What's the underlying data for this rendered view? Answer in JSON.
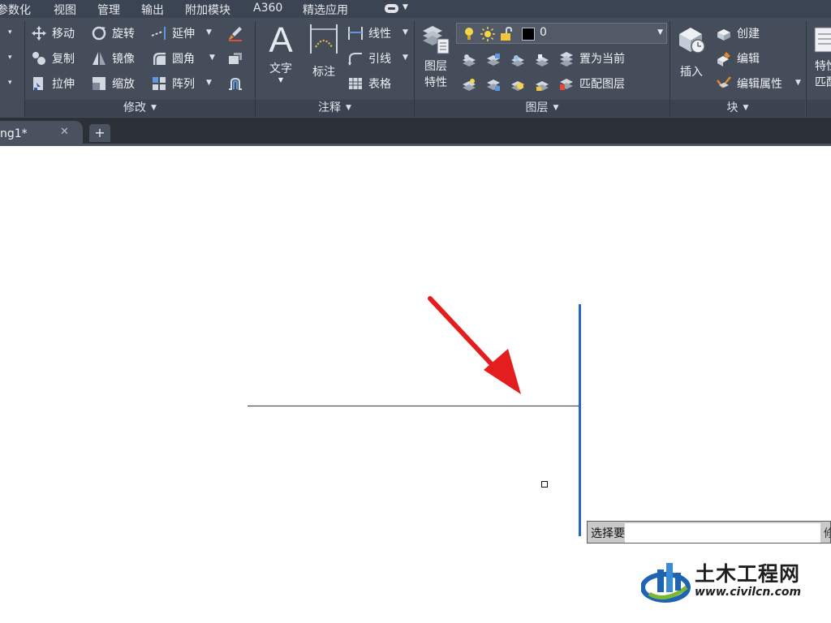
{
  "menu": {
    "items": [
      "参数化",
      "视图",
      "管理",
      "输出",
      "附加模块",
      "A360",
      "精选应用"
    ]
  },
  "ribbon": {
    "left_partial_arrows": [
      "▾",
      "▾",
      "▾"
    ],
    "modify": {
      "buttons": [
        "移动",
        "旋转",
        "延伸",
        "复制",
        "镜像",
        "圆角",
        "拉伸",
        "缩放",
        "阵列"
      ],
      "title": "修改"
    },
    "annotation": {
      "text_label": "文字",
      "dimension_label": "标注",
      "linear": "线性",
      "leader": "引线",
      "table": "表格",
      "title": "注释"
    },
    "layers": {
      "properties_line1": "图层",
      "properties_line2": "特性",
      "current_layer": "0",
      "set_current": "置为当前",
      "match_layer": "匹配图层",
      "title": "图层"
    },
    "block": {
      "insert": "插入",
      "create": "创建",
      "edit": "编辑",
      "edit_attributes": "编辑属性",
      "title": "块"
    },
    "properties_partial": {
      "line1": "特性",
      "line2": "匹配"
    }
  },
  "tabs": {
    "document_tab": "ng1*",
    "close_glyph": "✕",
    "new_tab_glyph": "+"
  },
  "canvas": {
    "tooltip_left": "选择要",
    "tooltip_right": "修"
  },
  "watermark": {
    "name_cn": "土木工程网",
    "url": "www.civilcn.com"
  },
  "colors": {
    "menubar": "#3b4453",
    "ribbon": "#454d5a",
    "selected_line": "#2b63c8",
    "arrow": "#e41e1e"
  }
}
